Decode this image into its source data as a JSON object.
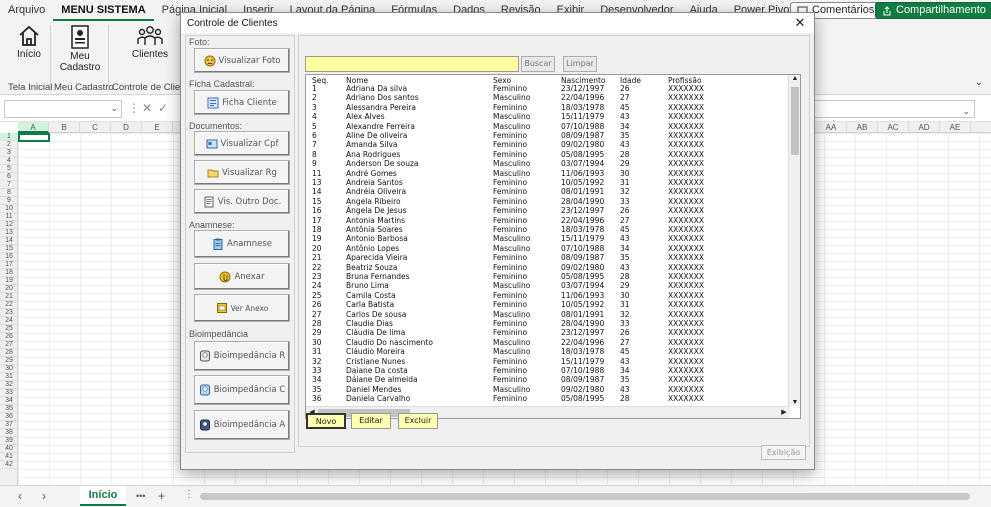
{
  "ribbon": {
    "tabs": [
      "Arquivo",
      "MENU SISTEMA",
      "Página Inicial",
      "Inserir",
      "Layout da Página",
      "Fórmulas",
      "Dados",
      "Revisão",
      "Exibir",
      "Desenvolvedor",
      "Ajuda",
      "Power Pivot"
    ],
    "active_tab": "MENU SISTEMA",
    "comments_label": "Comentários",
    "share_label": "Compartilhamento",
    "buttons": {
      "inicio": "Início",
      "meu_cadastro": "Meu Cadastro",
      "clientes": "Clientes"
    },
    "groups": {
      "tela_inicial": "Tela Inicial",
      "meu_cadastro": "Meu Cadastro",
      "controle_clientes": "Controle de Clientes"
    }
  },
  "formula_bar": {
    "cancel_symbol": "✕",
    "enter_symbol": "✓"
  },
  "grid": {
    "columns_left": [
      "A",
      "B",
      "C",
      "D",
      "E"
    ],
    "columns_right": [
      "AA",
      "AB",
      "AC",
      "AD",
      "AE"
    ],
    "row_count": 42
  },
  "sheet": {
    "tab_label": "Início",
    "more": "•••",
    "add": "+"
  },
  "dialog": {
    "title": "Controle de Clientes",
    "close": "✕",
    "sections": {
      "foto": "Foto:",
      "ficha": "Ficha Cadastral:",
      "documentos": "Documentos:",
      "anamnese": "Anamnese:",
      "bioimpedancia": "Bioimpedância"
    },
    "side_buttons": {
      "visualizar_foto": "Visualizar Foto",
      "ficha_cliente": "Ficha Cliente",
      "visualizar_cpf": "Visualizar Cpf",
      "visualizar_rg": "Visualizar Rg",
      "vis_outro_doc": "Vis. Outro Doc.",
      "anamnese": "Anamnese",
      "anexar": "Anexar",
      "ver_anexo": "Ver Anexo",
      "bio_r": "Bioimpedância R",
      "bio_c": "Bioimpedância C",
      "bio_a": "Bioimpedância A"
    },
    "search": {
      "value": "",
      "buscar": "Buscar",
      "limpar": "Limpar"
    },
    "list": {
      "headers": [
        "Seq.",
        "Nome",
        "Sexo",
        "Nascimento",
        "Idade",
        "Profissão"
      ],
      "rows": [
        [
          "1",
          "Adriana Da silva",
          "Feminino",
          "23/12/1997",
          "26",
          "XXXXXXX"
        ],
        [
          "2",
          "Adriano Dos santos",
          "Masculino",
          "22/04/1996",
          "27",
          "XXXXXXX"
        ],
        [
          "3",
          "Alessandra Pereira",
          "Feminino",
          "18/03/1978",
          "45",
          "XXXXXXX"
        ],
        [
          "4",
          "Alex Alves",
          "Masculino",
          "15/11/1979",
          "43",
          "XXXXXXX"
        ],
        [
          "5",
          "Alexandre Ferreira",
          "Masculino",
          "07/10/1988",
          "34",
          "XXXXXXX"
        ],
        [
          "6",
          "Aline De oliveira",
          "Feminino",
          "08/09/1987",
          "35",
          "XXXXXXX"
        ],
        [
          "7",
          "Amanda Silva",
          "Feminino",
          "09/02/1980",
          "43",
          "XXXXXXX"
        ],
        [
          "8",
          "Ana Rodrigues",
          "Feminino",
          "05/08/1995",
          "28",
          "XXXXXXX"
        ],
        [
          "9",
          "Anderson De souza",
          "Masculino",
          "03/07/1994",
          "29",
          "XXXXXXX"
        ],
        [
          "11",
          "André Gomes",
          "Masculino",
          "11/06/1993",
          "30",
          "XXXXXXX"
        ],
        [
          "13",
          "Andreia Santos",
          "Feminino",
          "10/05/1992",
          "31",
          "XXXXXXX"
        ],
        [
          "14",
          "Andréia Oliveira",
          "Feminino",
          "08/01/1991",
          "32",
          "XXXXXXX"
        ],
        [
          "15",
          "Angela Ribeiro",
          "Feminino",
          "28/04/1990",
          "33",
          "XXXXXXX"
        ],
        [
          "16",
          "Ângela De Jesus",
          "Feminino",
          "23/12/1997",
          "26",
          "XXXXXXX"
        ],
        [
          "17",
          "Antonia Martins",
          "Feminino",
          "22/04/1996",
          "27",
          "XXXXXXX"
        ],
        [
          "18",
          "Antônia Soares",
          "Feminino",
          "18/03/1978",
          "45",
          "XXXXXXX"
        ],
        [
          "19",
          "Antonio Barbosa",
          "Masculino",
          "15/11/1979",
          "43",
          "XXXXXXX"
        ],
        [
          "20",
          "Antônio Lopes",
          "Masculino",
          "07/10/1988",
          "34",
          "XXXXXXX"
        ],
        [
          "21",
          "Aparecida Vieira",
          "Feminino",
          "08/09/1987",
          "35",
          "XXXXXXX"
        ],
        [
          "22",
          "Beatriz Souza",
          "Feminino",
          "09/02/1980",
          "43",
          "XXXXXXX"
        ],
        [
          "23",
          "Bruna Fernandes",
          "Feminino",
          "05/08/1995",
          "28",
          "XXXXXXX"
        ],
        [
          "24",
          "Bruno Lima",
          "Masculino",
          "03/07/1994",
          "29",
          "XXXXXXX"
        ],
        [
          "25",
          "Camila Costa",
          "Feminino",
          "11/06/1993",
          "30",
          "XXXXXXX"
        ],
        [
          "26",
          "Carla Batista",
          "Feminino",
          "10/05/1992",
          "31",
          "XXXXXXX"
        ],
        [
          "27",
          "Carlos De sousa",
          "Masculino",
          "08/01/1991",
          "32",
          "XXXXXXX"
        ],
        [
          "28",
          "Claudia Dias",
          "Feminino",
          "28/04/1990",
          "33",
          "XXXXXXX"
        ],
        [
          "29",
          "Cláudia De lima",
          "Feminino",
          "23/12/1997",
          "26",
          "XXXXXXX"
        ],
        [
          "30",
          "Claudio Do nascimento",
          "Masculino",
          "22/04/1996",
          "27",
          "XXXXXXX"
        ],
        [
          "31",
          "Cláudio Moreira",
          "Masculino",
          "18/03/1978",
          "45",
          "XXXXXXX"
        ],
        [
          "32",
          "Cristiane Nunes",
          "Feminino",
          "15/11/1979",
          "43",
          "XXXXXXX"
        ],
        [
          "33",
          "Daiane Da costa",
          "Feminino",
          "07/10/1988",
          "34",
          "XXXXXXX"
        ],
        [
          "34",
          "Dáiane De almeida",
          "Feminino",
          "08/09/1987",
          "35",
          "XXXXXXX"
        ],
        [
          "35",
          "Daniel Mendes",
          "Masculino",
          "09/02/1980",
          "43",
          "XXXXXXX"
        ],
        [
          "36",
          "Daniela Carvalho",
          "Feminino",
          "05/08/1995",
          "28",
          "XXXXXXX"
        ]
      ]
    },
    "actions": {
      "novo": "Novo",
      "editar": "Editar",
      "excluir": "Excluir",
      "exibicao": "Exibição"
    }
  },
  "colors": {
    "excel_green": "#107c41",
    "search_bg": "#ffffa0",
    "action_bg": "#ffffb0"
  }
}
